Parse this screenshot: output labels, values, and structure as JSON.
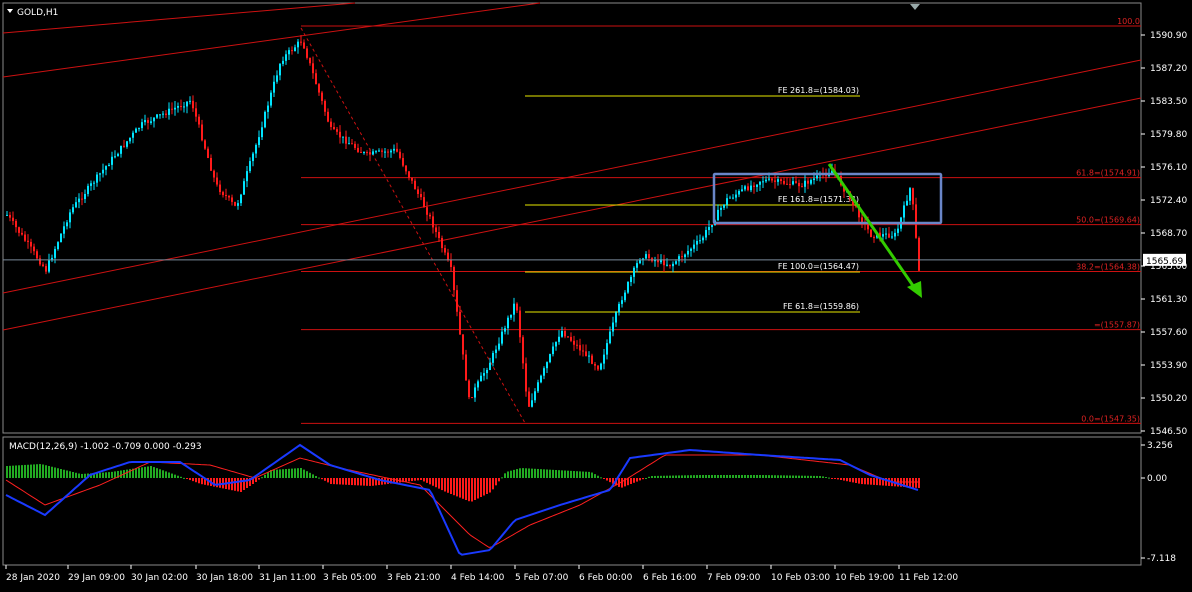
{
  "window_title": "GOLD,H1",
  "main_chart": {
    "symbol": "GOLD",
    "timeframe": "H1",
    "price_axis_labels": [
      "1590.90",
      "1587.20",
      "1583.50",
      "1579.80",
      "1576.10",
      "1572.40",
      "1568.70",
      "1565.00",
      "1561.30",
      "1557.60",
      "1553.90",
      "1550.20",
      "1546.50"
    ],
    "current_price": "1565.69",
    "fibonacci_retracement": {
      "levels": [
        {
          "label": "100.0",
          "value": 1590.9
        },
        {
          "label": "61.8=(1574.91)",
          "value": 1574.91
        },
        {
          "label": "50.0=(1569.64)",
          "value": 1569.64
        },
        {
          "label": "38.2=(1564.38)",
          "value": 1564.38
        },
        {
          "label": "=(1557.87)",
          "value": 1557.87
        },
        {
          "label": "0.0=(1547.35)",
          "value": 1547.35
        }
      ]
    },
    "fibonacci_expansion": {
      "levels": [
        {
          "label": "FE 261.8=(1584.03)",
          "value": 1584.03
        },
        {
          "label": "FE 161.8=(1571.34)",
          "value": 1571.34
        },
        {
          "label": "FE 100.0=(1564.47)",
          "value": 1564.47
        },
        {
          "label": "FE 61.8=(1559.86)",
          "value": 1559.86
        }
      ]
    },
    "colors": {
      "background": "#000000",
      "bull": "#00e5ff",
      "bear": "#ff1a1a",
      "fibo_red": "#cc1111",
      "fibo_yellow": "#e8e800",
      "arrow": "#33cc00",
      "rectangle": "#6a86c8"
    }
  },
  "macd": {
    "label": "MACD(12,26,9) -1.002 -0.709 0.000 -0.293",
    "axis_labels": [
      "3.256",
      "0.00",
      "-7.118"
    ]
  },
  "time_axis_labels": [
    "28 Jan 2020",
    "29 Jan 09:00",
    "30 Jan 02:00",
    "30 Jan 18:00",
    "31 Jan 11:00",
    "3 Feb 05:00",
    "3 Feb 21:00",
    "4 Feb 14:00",
    "5 Feb 07:00",
    "6 Feb 00:00",
    "6 Feb 16:00",
    "7 Feb 09:00",
    "10 Feb 03:00",
    "10 Feb 19:00",
    "11 Feb 12:00"
  ]
}
